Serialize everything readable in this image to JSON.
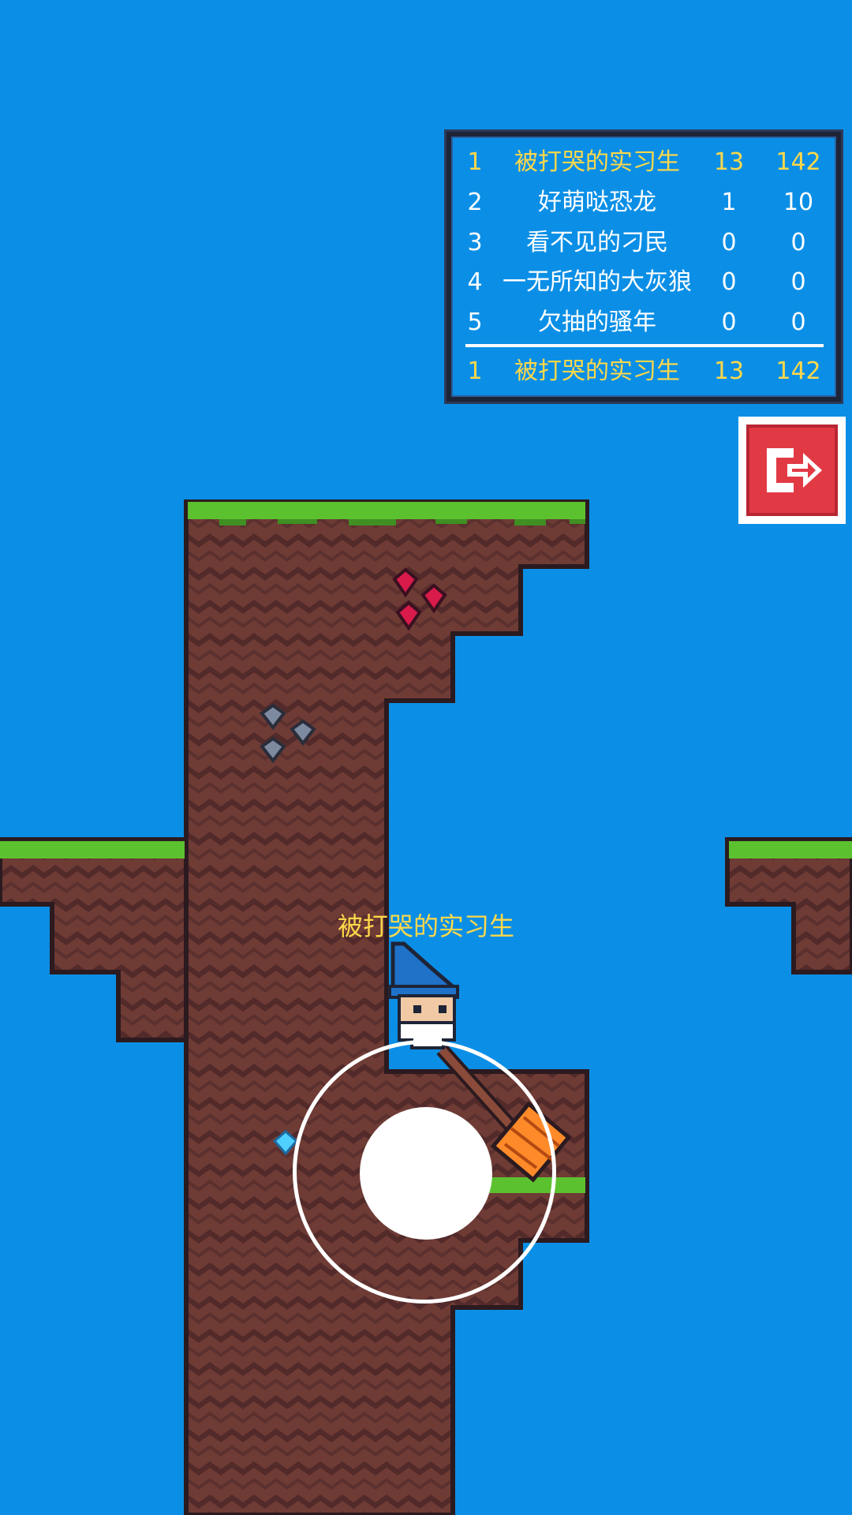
{
  "leaderboard": {
    "rows": [
      {
        "rank": "1",
        "name": "被打哭的实习生",
        "kills": "13",
        "score": "142"
      },
      {
        "rank": "2",
        "name": "好萌哒恐龙",
        "kills": "1",
        "score": "10"
      },
      {
        "rank": "3",
        "name": "看不见的刁民",
        "kills": "0",
        "score": "0"
      },
      {
        "rank": "4",
        "name": "一无所知的大灰狼",
        "kills": "0",
        "score": "0"
      },
      {
        "rank": "5",
        "name": "欠抽的骚年",
        "kills": "0",
        "score": "0"
      }
    ],
    "self": {
      "rank": "1",
      "name": "被打哭的实习生",
      "kills": "13",
      "score": "142"
    }
  },
  "player": {
    "name": "被打哭的实习生"
  },
  "icons": {
    "exit": "exit-door-arrow-icon",
    "weapon": "torch-club-icon"
  },
  "colors": {
    "sky": "#0b8fe6",
    "dirt": "#6b3a34",
    "grass": "#5cc12f",
    "highlight_text": "#ffd84a",
    "exit_button": "#e23a45"
  }
}
